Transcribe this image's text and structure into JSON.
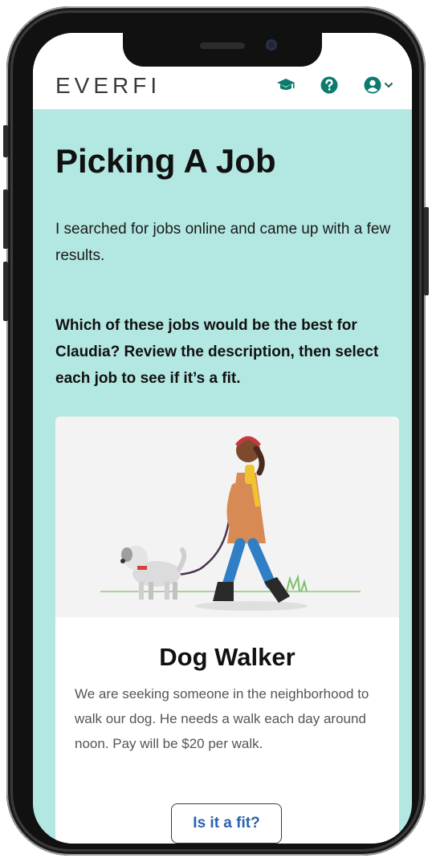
{
  "header": {
    "logo": "EVERFI",
    "icons": [
      "graduation-cap-icon",
      "help-icon",
      "user-icon",
      "chevron-down-icon"
    ]
  },
  "page": {
    "title": "Picking A Job",
    "intro": "I searched for jobs online and came up with a few results.",
    "question": "Which of these jobs would be the best for Claudia? Review the description, then select each job to see if it’s a fit."
  },
  "card": {
    "job_title": "Dog Walker",
    "description": "We are seeking someone in the neighborhood to walk our dog. He needs a walk each day around noon. Pay will be $20 per walk.",
    "button_label": "Is it a fit?"
  },
  "colors": {
    "background": "#b3e7e1",
    "accent": "#0d7a6e",
    "button_text": "#2b63b0"
  }
}
